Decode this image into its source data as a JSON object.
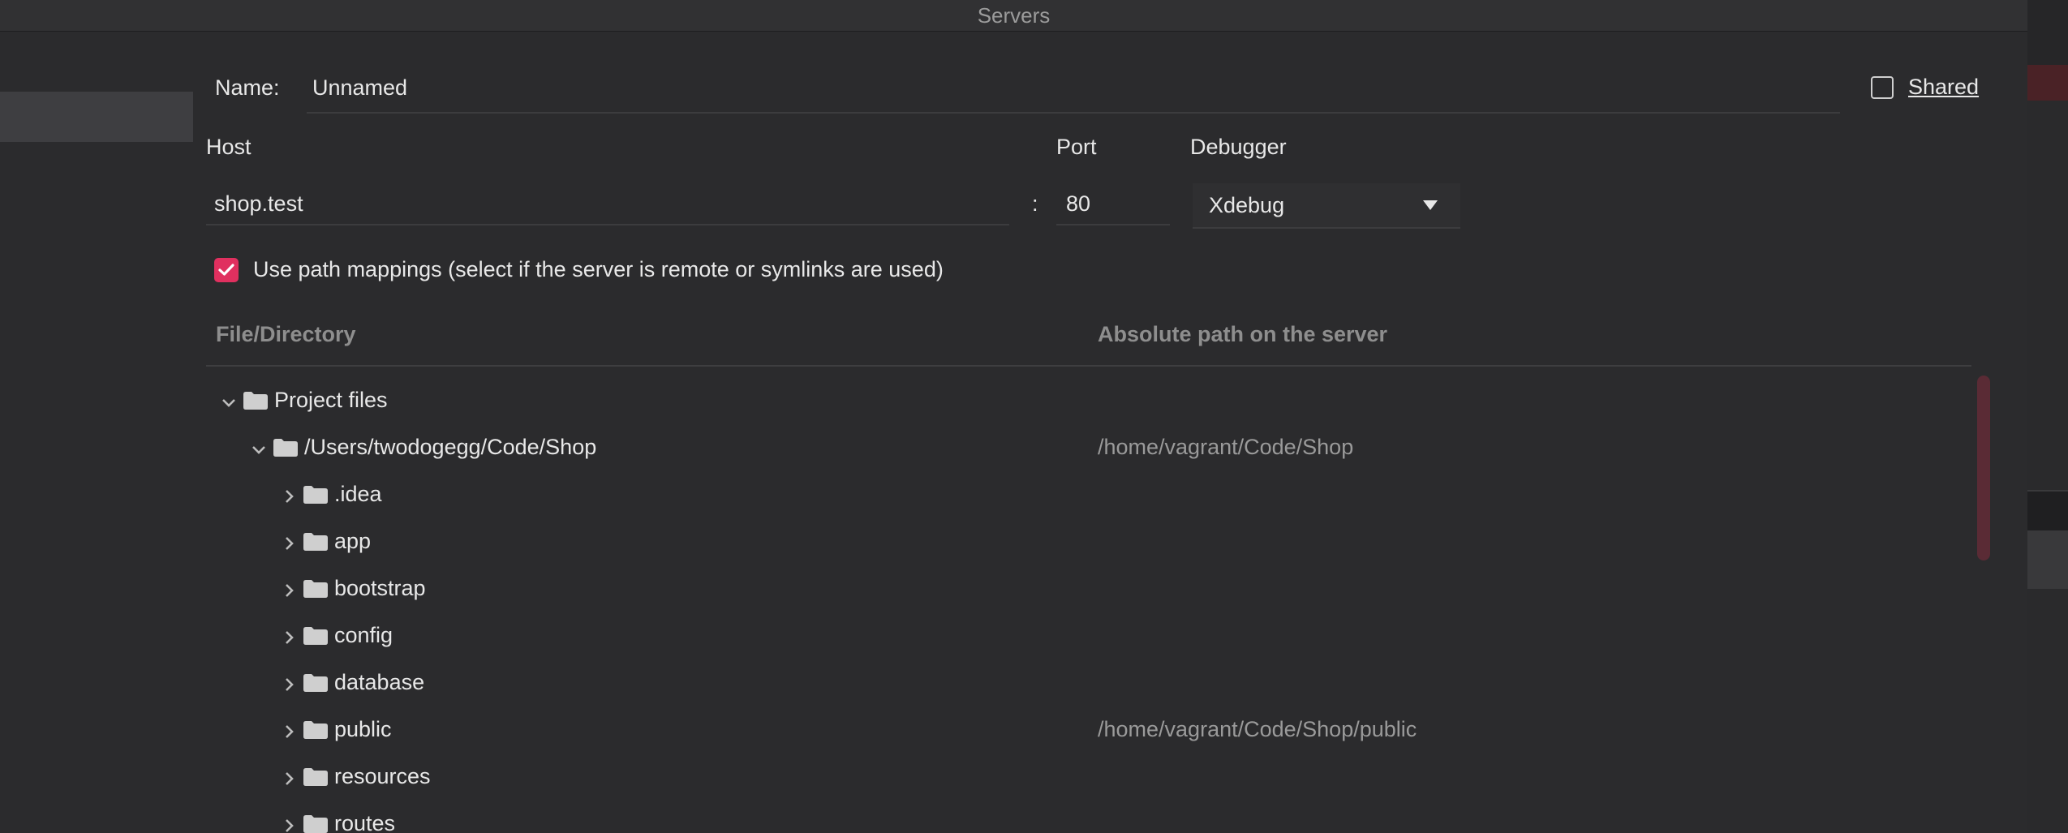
{
  "window": {
    "title": "Servers"
  },
  "form": {
    "name_label": "Name:",
    "name_value": "Unnamed",
    "shared_label": "Shared",
    "shared_checked": false,
    "host_label": "Host",
    "host_value": "shop.test",
    "port_separator": ":",
    "port_label": "Port",
    "port_value": "80",
    "debugger_label": "Debugger",
    "debugger_value": "Xdebug",
    "path_mappings_label": "Use path mappings (select if the server is remote or symlinks are used)",
    "path_mappings_checked": true
  },
  "mappings": {
    "columns": [
      "File/Directory",
      "Absolute path on the server"
    ],
    "rows": [
      {
        "label": "Project files",
        "depth": 0,
        "expanded": true,
        "mapped": ""
      },
      {
        "label": "/Users/twodogegg/Code/Shop",
        "depth": 1,
        "expanded": true,
        "mapped": "/home/vagrant/Code/Shop"
      },
      {
        "label": ".idea",
        "depth": 2,
        "expanded": false,
        "mapped": ""
      },
      {
        "label": "app",
        "depth": 2,
        "expanded": false,
        "mapped": ""
      },
      {
        "label": "bootstrap",
        "depth": 2,
        "expanded": false,
        "mapped": ""
      },
      {
        "label": "config",
        "depth": 2,
        "expanded": false,
        "mapped": ""
      },
      {
        "label": "database",
        "depth": 2,
        "expanded": false,
        "mapped": ""
      },
      {
        "label": "public",
        "depth": 2,
        "expanded": false,
        "mapped": "/home/vagrant/Code/Shop/public"
      },
      {
        "label": "resources",
        "depth": 2,
        "expanded": false,
        "mapped": ""
      },
      {
        "label": "routes",
        "depth": 2,
        "expanded": false,
        "mapped": ""
      }
    ]
  },
  "colors": {
    "accent": "#e0305f",
    "background": "#2b2b2d",
    "text": "#e8e8e8",
    "muted_text": "#9a9a9a",
    "folder_icon": "#cfcfcf"
  },
  "icons": {
    "expanded": "chevron-down-icon",
    "collapsed": "chevron-right-icon",
    "folder": "folder-icon",
    "check": "check-icon",
    "dropdown": "dropdown-arrow-icon"
  }
}
